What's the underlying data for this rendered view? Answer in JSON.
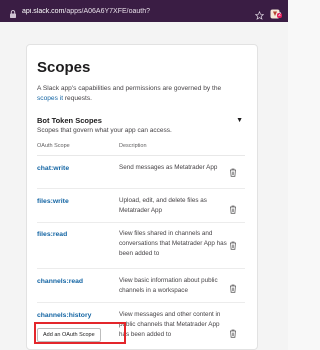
{
  "browser": {
    "url_host": "api.slack.com",
    "url_path": "/apps/A06A6Y7XFE/oauth?",
    "badge": "2"
  },
  "card": {
    "title": "Scopes",
    "description_prefix": "A Slack app's capabilities and permissions are governed by the ",
    "description_link": "scopes it",
    "description_suffix": " requests."
  },
  "bot_token_scopes": {
    "title": "Bot Token Scopes",
    "subtitle": "Scopes that govern what your app can access.",
    "col_scope": "OAuth Scope",
    "col_description": "Description",
    "rows": [
      {
        "scope": "chat:write",
        "description": "Send messages as Metatrader App"
      },
      {
        "scope": "files:write",
        "description": "Upload, edit, and delete files as Metatrader App"
      },
      {
        "scope": "files:read",
        "description": "View files shared in channels and conversations that Metatrader App has been added to"
      },
      {
        "scope": "channels:read",
        "description": "View basic information about public channels in a workspace"
      },
      {
        "scope": "channels:history",
        "description": "View messages and other content in public channels that Metatrader App has been added to"
      }
    ],
    "add_button": "Add an OAuth Scope"
  },
  "colors": {
    "browser_bar": "#3a1d44",
    "link": "#1264a3",
    "highlight": "#e3262b"
  },
  "icons": [
    "lock-icon",
    "star-icon",
    "extension-icon",
    "caret-down-icon",
    "trash-icon"
  ]
}
